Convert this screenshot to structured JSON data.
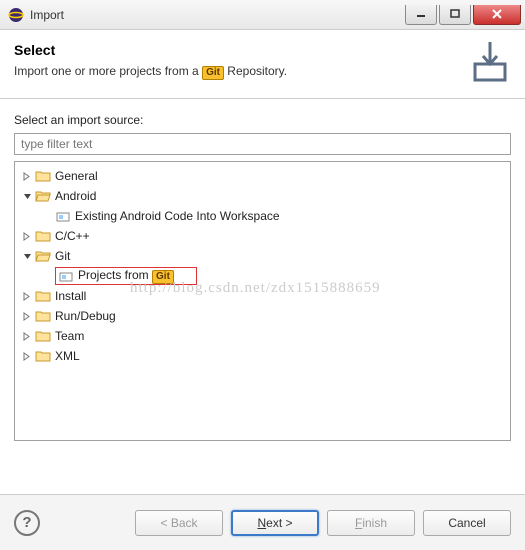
{
  "window": {
    "title": "Import"
  },
  "banner": {
    "heading": "Select",
    "desc_prefix": "Import one or more projects from a ",
    "desc_badge": "Git",
    "desc_suffix": " Repository."
  },
  "label": "Select an import source:",
  "filter": {
    "placeholder": "type filter text"
  },
  "tree": {
    "general": "General",
    "android": "Android",
    "android_item": "Existing Android Code Into Workspace",
    "ccpp": "C/C++",
    "git": "Git",
    "git_item_prefix": "Projects from ",
    "git_item_badge": "Git",
    "install": "Install",
    "rundebug": "Run/Debug",
    "team": "Team",
    "xml": "XML"
  },
  "buttons": {
    "back": "< Back",
    "next_u": "N",
    "next_rest": "ext >",
    "finish_u": "F",
    "finish_rest": "inish",
    "cancel": "Cancel"
  },
  "watermark": "http://blog.csdn.net/zdx1515888659"
}
